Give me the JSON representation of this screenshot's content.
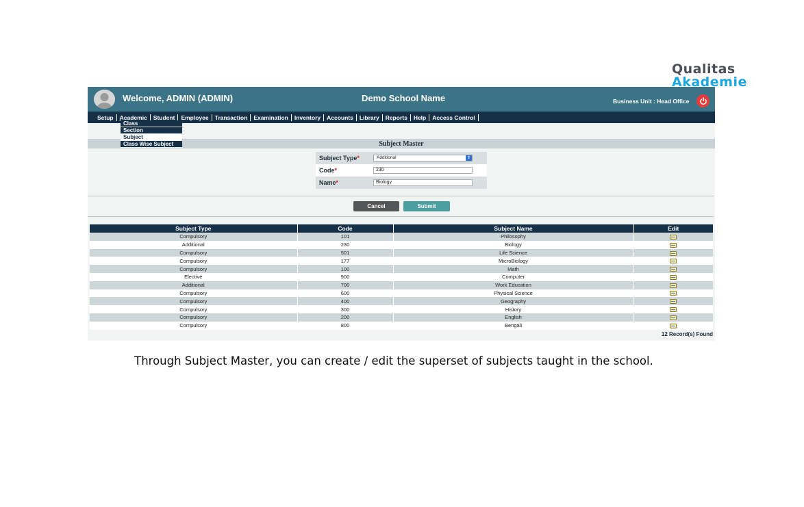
{
  "logo": {
    "line1": "Qualitas",
    "line2": "Akademie"
  },
  "header": {
    "welcome": "Welcome, ADMIN (ADMIN)",
    "school_name": "Demo School Name",
    "business_unit": "Business Unit : Head Office"
  },
  "nav": {
    "items": [
      "Setup",
      "Academic",
      "Student",
      "Employee",
      "Transaction",
      "Examination",
      "Inventory",
      "Accounts",
      "Library",
      "Reports",
      "Help",
      "Access Control"
    ],
    "dropdown": [
      "Class",
      "Section",
      "Subject",
      "Class Wise Subject"
    ]
  },
  "page": {
    "title": "Subject Master"
  },
  "form": {
    "subject_type_label": "Subject Type",
    "subject_type_value": "Additional",
    "code_label": "Code",
    "code_value": "230",
    "name_label": "Name",
    "name_value": "Biology",
    "required_mark": "*"
  },
  "buttons": {
    "cancel": "Cancel",
    "submit": "Submit"
  },
  "table": {
    "headers": [
      "Subject Type",
      "Code",
      "Subject Name",
      "Edit"
    ],
    "rows": [
      [
        "Compulsory",
        "101",
        "Philosophy"
      ],
      [
        "Additional",
        "230",
        "Biology"
      ],
      [
        "Compulsory",
        "501",
        "Life Science"
      ],
      [
        "Compulsory",
        "177",
        "MicroBiology"
      ],
      [
        "Compulsory",
        "100",
        "Math"
      ],
      [
        "Elective",
        "900",
        "Computer"
      ],
      [
        "Additional",
        "700",
        "Work Education"
      ],
      [
        "Compulsory",
        "600",
        "Physical Science"
      ],
      [
        "Compulsory",
        "400",
        "Geography"
      ],
      [
        "Compulsory",
        "300",
        "History"
      ],
      [
        "Compulsory",
        "200",
        "English"
      ],
      [
        "Compulsory",
        "800",
        "Bengali"
      ]
    ],
    "records_found": "12 Record(s) Found"
  },
  "caption": "Through Subject Master, you can create / edit the superset of subjects taught in the school.",
  "colors": {
    "header": "#3b7487",
    "navbar": "#163048",
    "submit": "#4d9e9e",
    "cancel": "#555658",
    "power": "#e83a3a"
  },
  "icons": {
    "avatar": "user-avatar-icon",
    "power": "power-icon",
    "edit": "edit-icon",
    "select": "chevron-updown-icon"
  }
}
